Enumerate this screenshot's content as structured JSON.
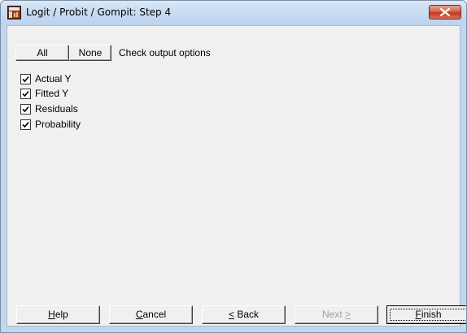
{
  "window": {
    "title": "Logit / Probit / Gompit: Step 4"
  },
  "toolbar": {
    "all_label": "All",
    "none_label": "None",
    "instruction": "Check output options"
  },
  "options": [
    {
      "label": "Actual Y",
      "checked": true
    },
    {
      "label": "Fitted Y",
      "checked": true
    },
    {
      "label": "Residuals",
      "checked": true
    },
    {
      "label": "Probability",
      "checked": true
    }
  ],
  "footer": {
    "help": {
      "mnemonic": "H",
      "rest": "elp"
    },
    "cancel": {
      "mnemonic": "C",
      "rest": "ancel"
    },
    "back": {
      "mnemonic": "<",
      "rest": " Back"
    },
    "next": {
      "prefix": "Next ",
      "mnemonic": ">"
    },
    "finish": {
      "mnemonic": "F",
      "rest": "inish"
    }
  },
  "colors": {
    "client_background": "#f0f0f0",
    "title_bar": "#c9dcf2",
    "close_button": "#c0391f"
  }
}
